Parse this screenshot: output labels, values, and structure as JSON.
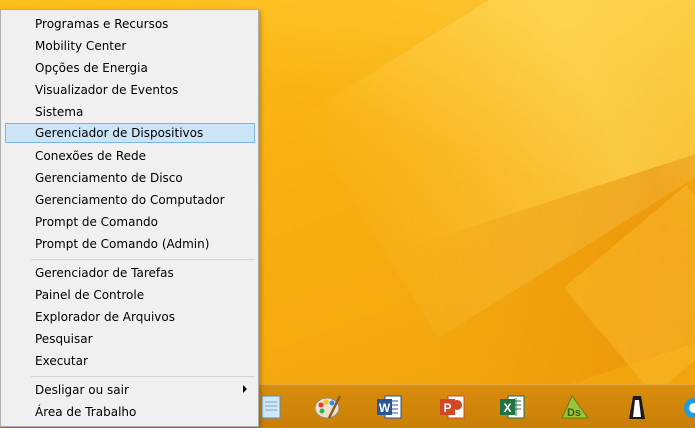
{
  "menu": {
    "items": [
      {
        "label": "Programas e Recursos"
      },
      {
        "label": "Mobility Center"
      },
      {
        "label": "Opções de Energia"
      },
      {
        "label": "Visualizador de Eventos"
      },
      {
        "label": "Sistema"
      },
      {
        "label": "Gerenciador de Dispositivos",
        "selected": true
      },
      {
        "label": "Conexões de Rede"
      },
      {
        "label": "Gerenciamento de Disco"
      },
      {
        "label": "Gerenciamento do Computador"
      },
      {
        "label": "Prompt de Comando"
      },
      {
        "label": "Prompt de Comando (Admin)"
      },
      {
        "label": "Gerenciador de Tarefas"
      },
      {
        "label": "Painel de Controle"
      },
      {
        "label": "Explorador de Arquivos"
      },
      {
        "label": "Pesquisar"
      },
      {
        "label": "Executar"
      },
      {
        "label": "Desligar ou sair",
        "submenu": true
      },
      {
        "label": "Área de Trabalho"
      }
    ]
  },
  "taskbar": {
    "icons": [
      "notepad-icon",
      "paint-icon",
      "word-icon",
      "powerpoint-icon",
      "excel-icon",
      "dreamweaver-icon",
      "app-icon",
      "internet-explorer-icon"
    ],
    "word_letter": "W",
    "powerpoint_letter": "P",
    "excel_letter": "X",
    "dreamweaver_letters": "Ds"
  },
  "colors": {
    "desktop": "#f8ae10",
    "taskbar": "#d98d0c",
    "menu_bg": "#f0f0f0",
    "selection_bg": "#cce4f7",
    "selection_border": "#7eb4ea"
  }
}
